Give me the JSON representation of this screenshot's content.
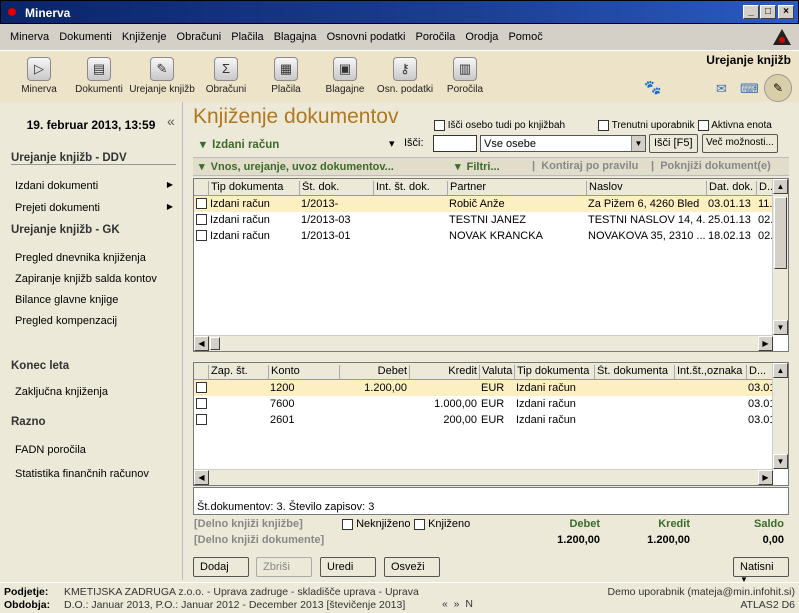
{
  "window": {
    "title": "Minerva"
  },
  "menu": [
    "Minerva",
    "Dokumenti",
    "Knjiženje",
    "Obračuni",
    "Plačila",
    "Blagajna",
    "Osnovni podatki",
    "Poročila",
    "Orodja",
    "Pomoč"
  ],
  "toolbar": {
    "items": [
      {
        "label": "Minerva",
        "icon": "play-icon"
      },
      {
        "label": "Dokumenti",
        "icon": "document-icon"
      },
      {
        "label": "Urejanje knjižb",
        "icon": "book-icon"
      },
      {
        "label": "Obračuni",
        "icon": "calculator-icon"
      },
      {
        "label": "Plačila",
        "icon": "payment-icon"
      },
      {
        "label": "Blagajne",
        "icon": "cashbox-icon"
      },
      {
        "label": "Osn. podatki",
        "icon": "key-icon"
      },
      {
        "label": "Poročila",
        "icon": "chart-icon"
      }
    ],
    "mode_label": "Urejanje knjižb"
  },
  "sidebar": {
    "date": "19. februar 2013, 13:59",
    "collapse": "«",
    "sections": [
      {
        "title": "Urejanje knjižb - DDV",
        "items": [
          {
            "label": "Izdani dokumenti",
            "arrow": "▶"
          },
          {
            "label": "Prejeti dokumenti",
            "arrow": "▶"
          }
        ]
      },
      {
        "title": "Urejanje knjižb - GK",
        "items": [
          {
            "label": "Pregled dnevnika knjiženja"
          },
          {
            "label": "Zapiranje knjižb salda kontov"
          },
          {
            "label": "Bilance glavne knjige"
          },
          {
            "label": "Pregled kompenzacij"
          }
        ]
      },
      {
        "title": "Konec leta",
        "items": [
          {
            "label": "Zaključna knjiženja"
          }
        ]
      },
      {
        "title": "Razno",
        "items": [
          {
            "label": "FADN poročila"
          },
          {
            "label": "Statistika finančnih računov"
          }
        ]
      }
    ]
  },
  "main": {
    "title": "Knjiženje dokumentov",
    "filter_checks": {
      "search_all": "Išči osebo tudi po knjižbah",
      "current_user": "Trenutni uporabnik",
      "active": "Aktivna enota"
    },
    "doc_type": "Izdani račun",
    "search_label": "Išči:",
    "search_value": "",
    "person_select": "Vse osebe",
    "search_btn": "Išči [F5]",
    "more_btn": "Več možnosti...",
    "action_bar": {
      "entry": "Vnos, urejanje, uvoz dokumentov...",
      "filters": "Filtri...",
      "contra": "Kontiraj po pravilu",
      "post": "Poknjiži dokument(e)"
    },
    "doc_columns": [
      "Tip dokumenta",
      "Št. dok.",
      "Int. št. dok.",
      "Partner",
      "Naslov",
      "Dat. dok.",
      "D..."
    ],
    "doc_rows": [
      [
        "Izdani račun",
        "1/2013-",
        "",
        "Robič Anže",
        "Za Pižem 6, 4260 Bled",
        "03.01.13",
        "11."
      ],
      [
        "Izdani račun",
        "1/2013-03",
        "",
        "TESTNI JANEZ",
        "TESTNI NASLOV 14, 4...",
        "25.01.13",
        "02."
      ],
      [
        "Izdani račun",
        "1/2013-01",
        "",
        "NOVAK KRANCKA",
        "NOVAKOVA 35, 2310 ...",
        "18.02.13",
        "02."
      ]
    ],
    "entry_columns": [
      "Zap. št.",
      "Konto",
      "Debet",
      "Kredit",
      "Valuta",
      "Tip dokumenta",
      "Št. dokumenta",
      "Int.št.,oznaka",
      "D..."
    ],
    "entry_rows": [
      [
        "",
        "1200",
        "1.200,00",
        "",
        "EUR",
        "Izdani račun",
        "",
        "",
        "03.01"
      ],
      [
        "",
        "7600",
        "",
        "1.000,00",
        "EUR",
        "Izdani račun",
        "",
        "",
        "03.01"
      ],
      [
        "",
        "2601",
        "",
        "200,00",
        "EUR",
        "Izdani račun",
        "",
        "",
        "03.01"
      ]
    ],
    "summary": "Št.dokumentov: 3. Število zapisov: 3",
    "partial_entries": "[Delno knjiži knjižbe]",
    "partial_docs": "[Delno knjiži dokumente]",
    "unposted": "Neknjiženo",
    "posted": "Knjiženo",
    "totals": {
      "debet_label": "Debet",
      "kredit_label": "Kredit",
      "saldo_label": "Saldo",
      "debet": "1.200,00",
      "kredit": "1.200,00",
      "saldo": "0,00"
    },
    "buttons": {
      "add": "Dodaj",
      "delete": "Zbriši",
      "edit": "Uredi",
      "refresh": "Osveži",
      "settings": "Natisni"
    }
  },
  "status": {
    "company_label": "Podjetje:",
    "company": "KMETIJSKA ZADRUGA z.o.o. - Uprava zadruge - skladišče uprava - Uprava",
    "period_label": "Obdobja:",
    "period": "D.O.: Januar 2013, P.O.: Januar 2012 - December 2013 [števičenje 2013]",
    "nav": "«  »  N",
    "user": "Demo uporabnik (mateja@min.infohit.si)",
    "version": "ATLAS2 D6"
  }
}
